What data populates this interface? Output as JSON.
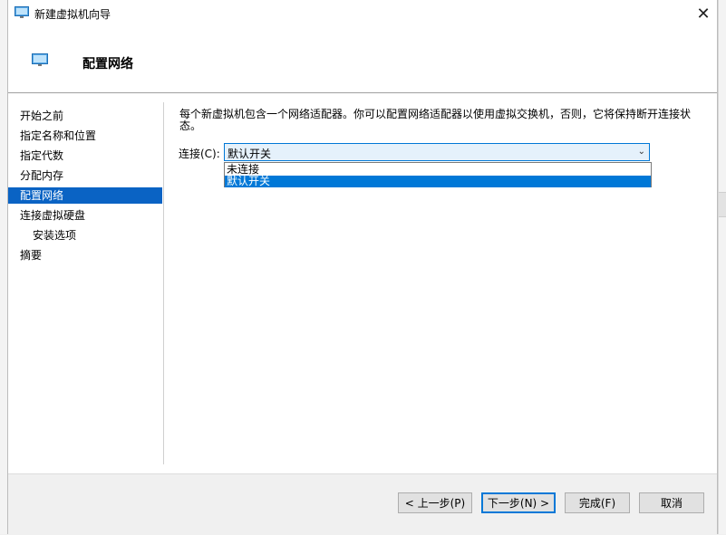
{
  "window": {
    "title": "新建虚拟机向导"
  },
  "header": {
    "title": "配置网络"
  },
  "nav": {
    "items": [
      {
        "label": "开始之前"
      },
      {
        "label": "指定名称和位置"
      },
      {
        "label": "指定代数"
      },
      {
        "label": "分配内存"
      },
      {
        "label": "配置网络",
        "active": true
      },
      {
        "label": "连接虚拟硬盘"
      },
      {
        "label": "安装选项",
        "indent": true
      },
      {
        "label": "摘要"
      }
    ]
  },
  "content": {
    "description": "每个新虚拟机包含一个网络适配器。你可以配置网络适配器以使用虚拟交换机，否则，它将保持断开连接状态。",
    "connection": {
      "label": "连接(C):",
      "selected": "默认开关",
      "options": [
        "未连接",
        "默认开关"
      ],
      "highlighted_index": 1
    }
  },
  "buttons": {
    "prev": "< 上一步(P)",
    "next": "下一步(N) >",
    "finish": "完成(F)",
    "cancel": "取消"
  },
  "colors": {
    "accent": "#0a63c4",
    "selection": "#0078d7"
  }
}
